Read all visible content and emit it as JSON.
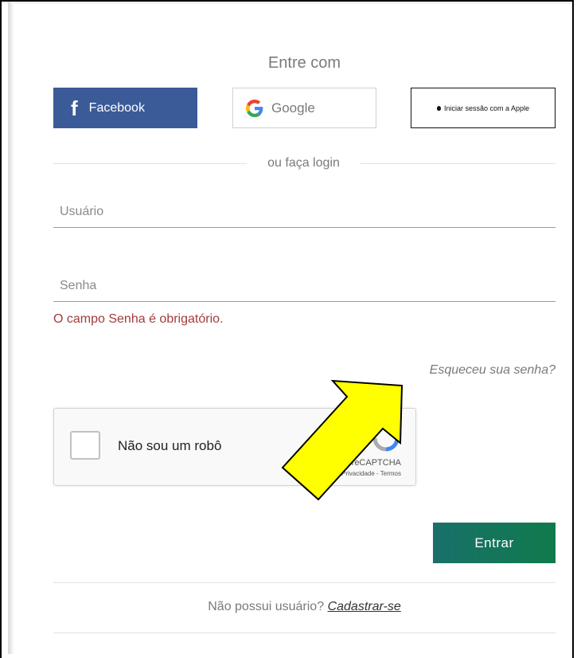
{
  "login": {
    "title": "Entre com",
    "social": {
      "facebook_label": "Facebook",
      "google_label": "Google",
      "apple_label": "Iniciar sessão com a Apple"
    },
    "divider_label": "ou faça login",
    "username": {
      "placeholder": "Usuário",
      "value": ""
    },
    "password": {
      "placeholder": "Senha",
      "value": ""
    },
    "password_error": "O campo Senha é obrigatório.",
    "forgot_password": "Esqueceu sua senha?",
    "recaptcha": {
      "label": "Não sou um robô",
      "brand": "reCAPTCHA",
      "terms": "Privacidade - Termos"
    },
    "submit_label": "Entrar",
    "signup_prompt": "Não possui usuário?",
    "signup_link": "Cadastrar-se"
  },
  "annotation": {
    "arrow_color": "#ffff00",
    "arrow_outline": "#000000",
    "arrow_icon": "arrow-pointer-icon"
  },
  "colors": {
    "facebook": "#3b5b98",
    "submit": "#137462",
    "error": "#a23b3b"
  }
}
